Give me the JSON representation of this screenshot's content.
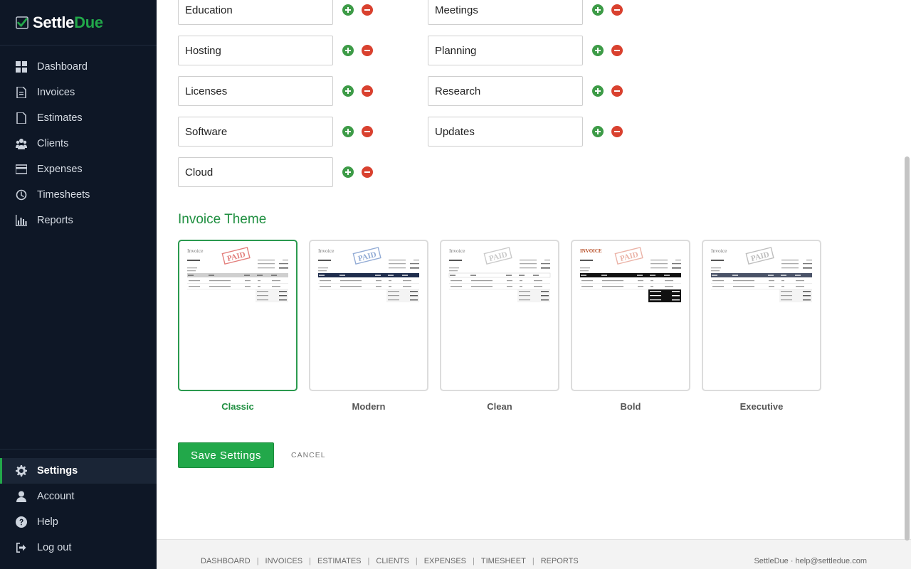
{
  "brand": {
    "part1": "Settle",
    "part2": "Due"
  },
  "nav": [
    {
      "label": "Dashboard",
      "icon": "dashboard-icon"
    },
    {
      "label": "Invoices",
      "icon": "invoice-icon"
    },
    {
      "label": "Estimates",
      "icon": "estimate-icon"
    },
    {
      "label": "Clients",
      "icon": "clients-icon"
    },
    {
      "label": "Expenses",
      "icon": "credit-card-icon"
    },
    {
      "label": "Timesheets",
      "icon": "clock-icon"
    },
    {
      "label": "Reports",
      "icon": "bar-chart-icon"
    }
  ],
  "nav_bottom": [
    {
      "label": "Settings",
      "icon": "gear-icon",
      "active": true
    },
    {
      "label": "Account",
      "icon": "user-icon"
    },
    {
      "label": "Help",
      "icon": "question-icon"
    },
    {
      "label": "Log out",
      "icon": "logout-icon"
    }
  ],
  "categories": {
    "left": [
      "Education",
      "Hosting",
      "Licenses",
      "Software",
      "Cloud"
    ],
    "right": [
      "Meetings",
      "Planning",
      "Research",
      "Updates"
    ]
  },
  "theme_section": {
    "title": "Invoice Theme"
  },
  "themes": [
    {
      "name": "Classic",
      "selected": true,
      "header_color": "#cfcfcf",
      "title": "Invoice",
      "stamp": "PAID",
      "stamp_color": "#d9534f"
    },
    {
      "name": "Modern",
      "selected": false,
      "header_color": "#1f2d4d",
      "title": "Invoice",
      "stamp": "PAID",
      "stamp_color": "#6d8fc7"
    },
    {
      "name": "Clean",
      "selected": false,
      "header_color": "#ffffff",
      "title": "Invoice",
      "stamp": "PAID",
      "stamp_color": "#b8b8b8"
    },
    {
      "name": "Bold",
      "selected": false,
      "header_color": "#111111",
      "title": "INVOICE",
      "stamp": "PAID",
      "stamp_color": "#e49a8a"
    },
    {
      "name": "Executive",
      "selected": false,
      "header_color": "#4a5368",
      "title": "Invoice",
      "stamp": "PAID",
      "stamp_color": "#a8a8a8"
    }
  ],
  "actions": {
    "save_label": "Save Settings",
    "cancel_label": "CANCEL"
  },
  "footer": {
    "links": [
      "DASHBOARD",
      "INVOICES",
      "ESTIMATES",
      "CLIENTS",
      "EXPENSES",
      "TIMESHEET",
      "REPORTS"
    ],
    "right": "SettleDue · help@settledue.com"
  },
  "colors": {
    "accent": "#22a84a",
    "sidebar_bg": "#0e1726",
    "add": "#3d9b47",
    "remove": "#d9412f"
  }
}
